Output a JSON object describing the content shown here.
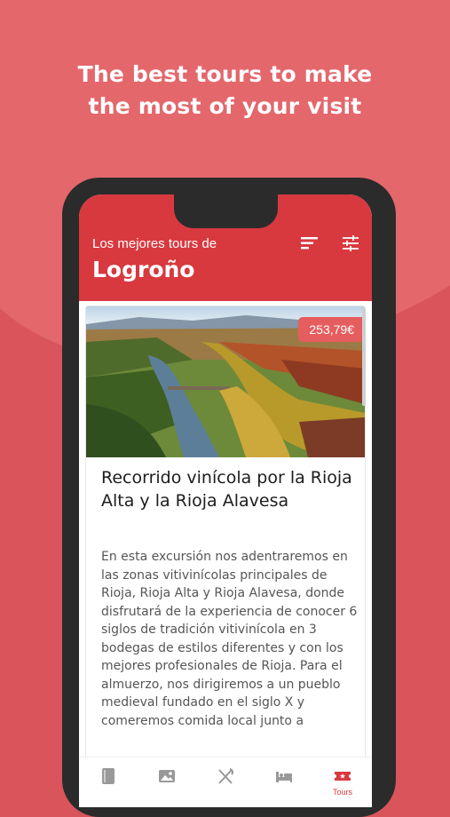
{
  "headline": {
    "line1": "The best tours to make",
    "line2": "the most of your visit"
  },
  "appbar": {
    "subtitle": "Los mejores tours de",
    "title": "Logroño",
    "sort_icon": "sort-icon",
    "filter_icon": "filter-sliders-icon"
  },
  "card": {
    "price": "253,79€",
    "title": "Recorrido vinícola por la Rioja Alta y la Rioja Alavesa",
    "description": "En esta excursión nos adentraremos en las zonas vitivinícolas principales de Rioja, Rioja Alta y Rioja Alavesa, donde disfrutará de la experiencia de conocer 6 siglos de tradición vitivinícola en 3 bodegas de estilos diferentes y con los mejores profesionales de Rioja. Para el almuerzo, nos dirigiremos a un pueblo medieval fundado en el siglo X y comeremos comida local junto a"
  },
  "tabs": [
    {
      "icon": "book-icon"
    },
    {
      "icon": "image-icon"
    },
    {
      "icon": "fork-knife-icon"
    },
    {
      "icon": "bed-icon"
    },
    {
      "icon": "ticket-icon",
      "label": "Tours",
      "active": true
    }
  ],
  "colors": {
    "accent": "#d8393f",
    "background": "#d9555b",
    "price_tag": "#e65d5f"
  }
}
